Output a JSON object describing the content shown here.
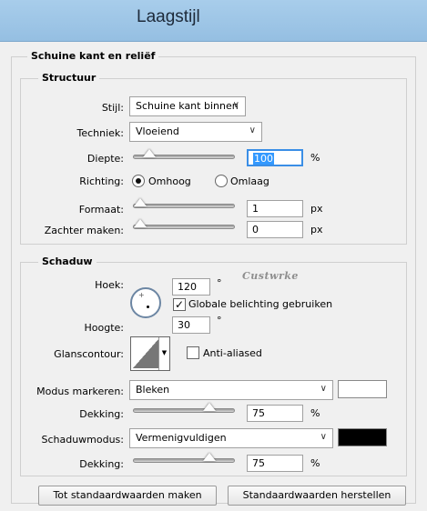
{
  "window": {
    "title": "Laagstijl"
  },
  "bevel_section": {
    "title": "Schuine kant en reliëf"
  },
  "structure": {
    "legend": "Structuur",
    "style_label": "Stijl:",
    "style_value": "Schuine kant binnen",
    "technique_label": "Techniek:",
    "technique_value": "Vloeiend",
    "depth_label": "Diepte:",
    "depth_value": "100",
    "depth_unit": "%",
    "depth_level": 0.15,
    "direction_label": "Richting:",
    "direction_up": "Omhoog",
    "direction_down": "Omlaag",
    "direction_selected": "up",
    "size_label": "Formaat:",
    "size_value": "1",
    "size_unit": "px",
    "size_level": 0.02,
    "soften_label": "Zachter maken:",
    "soften_value": "0",
    "soften_unit": "px",
    "soften_level": 0.0
  },
  "shading": {
    "legend": "Schaduw",
    "angle_label": "Hoek:",
    "angle_value": "120",
    "angle_unit": "°",
    "global_light_label": "Globale belichting gebruiken",
    "global_light_checked": true,
    "altitude_label": "Hoogte:",
    "altitude_value": "30",
    "altitude_unit": "°",
    "watermark": "Custwrke",
    "gloss_label": "Glanscontour:",
    "anti_aliased_label": "Anti-aliased",
    "anti_aliased_checked": false,
    "highlight_mode_label": "Modus markeren:",
    "highlight_mode_value": "Bleken",
    "highlight_color": "#ffffff",
    "highlight_opacity_label": "Dekking:",
    "highlight_opacity_value": "75",
    "highlight_opacity_unit": "%",
    "highlight_opacity_level": 0.75,
    "shadow_mode_label": "Schaduwmodus:",
    "shadow_mode_value": "Vermenigvuldigen",
    "shadow_color": "#000000",
    "shadow_opacity_label": "Dekking:",
    "shadow_opacity_value": "75",
    "shadow_opacity_unit": "%",
    "shadow_opacity_level": 0.75
  },
  "buttons": {
    "make_default": "Tot standaardwaarden maken",
    "reset_default": "Standaardwaarden herstellen"
  }
}
